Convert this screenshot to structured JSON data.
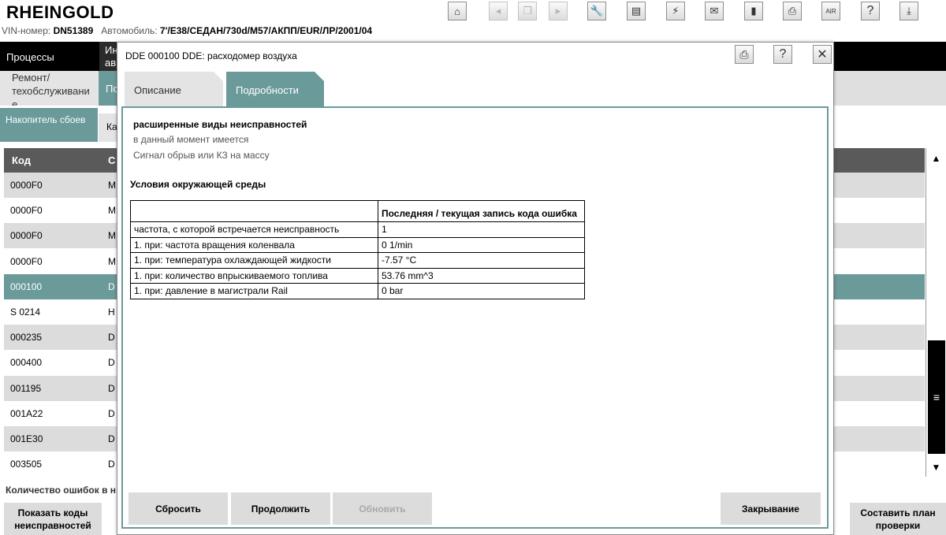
{
  "app": {
    "brand": "RHEINGOLD",
    "vin_label": "VIN-номер:",
    "vin": "DN51389",
    "vehicle_label": "Автомобиль:",
    "vehicle": "7'/E38/СЕДАН/730d/M57/АКПП/EUR/ЛР/2001/04"
  },
  "toolbar": {
    "icons": [
      "home-icon",
      "back-icon",
      "copy-icon",
      "forward-icon",
      "wrench-icon",
      "card-icon",
      "plug-icon",
      "mail-icon",
      "battery-icon",
      "print-icon",
      "air-icon",
      "help-icon",
      "download-icon"
    ],
    "air_text": "AIR",
    "help_text": "?"
  },
  "nav": {
    "processes": "Процессы",
    "info": "Ин ав",
    "repair": "Ремонт/ техобслуживани е",
    "teal_short": "По",
    "fault_memory": "Накопитель сбоев",
    "ka": "Ка"
  },
  "fault_table": {
    "headers": [
      "Код",
      "С"
    ],
    "rows": [
      {
        "code": "0000F0",
        "desc": "М"
      },
      {
        "code": "0000F0",
        "desc": "М"
      },
      {
        "code": "0000F0",
        "desc": "М"
      },
      {
        "code": "0000F0",
        "desc": "М"
      },
      {
        "code": "000100",
        "desc": "D"
      },
      {
        "code": "S 0214",
        "desc": "Н"
      },
      {
        "code": "000235",
        "desc": "D"
      },
      {
        "code": "000400",
        "desc": "D"
      },
      {
        "code": "001195",
        "desc": "D"
      },
      {
        "code": "001A22",
        "desc": "D"
      },
      {
        "code": "001E30",
        "desc": "D"
      },
      {
        "code": "003505",
        "desc": "D"
      }
    ],
    "selected_index": 4,
    "count_text": "Количество ошибок в н"
  },
  "bottom": {
    "show_codes": "Показать коды неисправностей",
    "make_plan": "Составить план проверки"
  },
  "dialog": {
    "title": "DDE 000100 DDE: расходомер воздуха",
    "tabs": [
      "Описание",
      "Подробности"
    ],
    "active_tab": 1,
    "ext_title": "расширенные виды неисправностей",
    "ext_lines": [
      "в данный момент имеется",
      "Сигнал обрыв или КЗ на массу"
    ],
    "env_title": "Условия окружающей среды",
    "env_header": "Последняя / текущая запись кода ошибка",
    "env_rows": [
      {
        "label": "частота, с которой встречается неисправность",
        "value": "1"
      },
      {
        "label": "1. при: частота вращения коленвала",
        "value": "0 1/min"
      },
      {
        "label": "1. при: температура охлаждающей жидкости",
        "value": "-7.57 °C"
      },
      {
        "label": "1. при: количество впрыскиваемого топлива",
        "value": "53.76 mm^3"
      },
      {
        "label": "1. при: давление в магистрали Rail",
        "value": "0 bar"
      }
    ],
    "buttons": {
      "reset": "Сбросить",
      "continue": "Продолжить",
      "update": "Обновить",
      "close": "Закрывание"
    },
    "close_x": "✕",
    "help": "?"
  },
  "colors": {
    "teal": "#6a9a9a",
    "header_gray": "#5a5a5a",
    "row_alt": "#dcdcdc"
  }
}
